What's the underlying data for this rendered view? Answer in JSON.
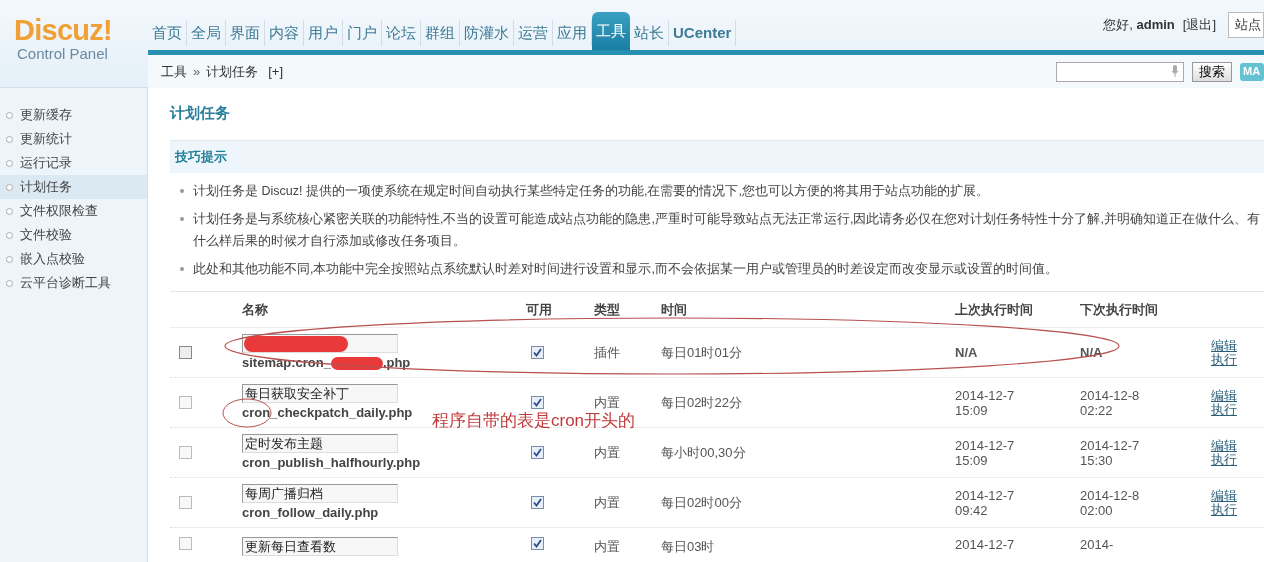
{
  "logo": {
    "title": "Discuz!",
    "subtitle": "Control Panel"
  },
  "nav": [
    {
      "label": "首页",
      "selected": false
    },
    {
      "label": "全局",
      "selected": false
    },
    {
      "label": "界面",
      "selected": false
    },
    {
      "label": "内容",
      "selected": false
    },
    {
      "label": "用户",
      "selected": false
    },
    {
      "label": "门户",
      "selected": false
    },
    {
      "label": "论坛",
      "selected": false
    },
    {
      "label": "群组",
      "selected": false
    },
    {
      "label": "防灌水",
      "selected": false
    },
    {
      "label": "运营",
      "selected": false
    },
    {
      "label": "应用",
      "selected": false
    },
    {
      "label": "工具",
      "selected": true
    },
    {
      "label": "站长",
      "selected": false
    },
    {
      "label": "UCenter",
      "selected": false
    }
  ],
  "user": {
    "greeting": "您好,",
    "name": "admin",
    "logout": "[退出]",
    "site_button": "站点"
  },
  "breadcrumb": {
    "parent": "工具",
    "separator": "»",
    "current": "计划任务",
    "add": "[+]"
  },
  "search": {
    "button": "搜索",
    "extra_button": "MA"
  },
  "sidebar": {
    "items": [
      {
        "label": "更新缓存",
        "selected": false
      },
      {
        "label": "更新统计",
        "selected": false
      },
      {
        "label": "运行记录",
        "selected": false
      },
      {
        "label": "计划任务",
        "selected": true
      },
      {
        "label": "文件权限检查",
        "selected": false
      },
      {
        "label": "文件校验",
        "selected": false
      },
      {
        "label": "嵌入点校验",
        "selected": false
      },
      {
        "label": "云平台诊断工具",
        "selected": false
      }
    ]
  },
  "page_title": "计划任务",
  "tips": {
    "title": "技巧提示",
    "items": [
      "计划任务是 Discuz! 提供的一项使系统在规定时间自动执行某些特定任务的功能,在需要的情况下,您也可以方便的将其用于站点功能的扩展。",
      "计划任务是与系统核心紧密关联的功能特性,不当的设置可能造成站点功能的隐患,严重时可能导致站点无法正常运行,因此请务必仅在您对计划任务特性十分了解,并明确知道正在做什么、有什么样后果的时候才自行添加或修改任务项目。",
      "此处和其他功能不同,本功能中完全按照站点系统默认时差对时间进行设置和显示,而不会依据某一用户或管理员的时差设定而改变显示或设置的时间值。"
    ]
  },
  "table": {
    "columns": [
      "名称",
      "可用",
      "类型",
      "时间",
      "上次执行时间",
      "下次执行时间"
    ],
    "rows": [
      {
        "selected": false,
        "name": "",
        "redacted": true,
        "file_prefix": "sitemap:cron_",
        "file_suffix": ".php",
        "enabled": true,
        "type": "插件",
        "time": "每日01时01分",
        "last_run": "N/A",
        "next_run": "N/A",
        "edit": "编辑",
        "run": "执行"
      },
      {
        "selected": false,
        "name": "每日获取安全补丁",
        "file_prefix": "cron_checkpatch_daily.php",
        "file_suffix": "",
        "enabled": true,
        "type": "内置",
        "time": "每日02时22分",
        "last_run": "2014-12-7 15:09",
        "next_run": "2014-12-8 02:22",
        "edit": "编辑",
        "run": "执行"
      },
      {
        "selected": false,
        "name": "定时发布主题",
        "file_prefix": "cron_publish_halfhourly.php",
        "file_suffix": "",
        "enabled": true,
        "type": "内置",
        "time": "每小时00,30分",
        "last_run": "2014-12-7 15:09",
        "next_run": "2014-12-7 15:30",
        "edit": "编辑",
        "run": "执行"
      },
      {
        "selected": false,
        "name": "每周广播归档",
        "file_prefix": "cron_follow_daily.php",
        "file_suffix": "",
        "enabled": true,
        "type": "内置",
        "time": "每日02时00分",
        "last_run": "2014-12-7 09:42",
        "next_run": "2014-12-8 02:00",
        "edit": "编辑",
        "run": "执行"
      },
      {
        "selected": false,
        "name": "更新每日查看数",
        "file_prefix": "",
        "file_suffix": "",
        "enabled": true,
        "type": "内置",
        "time": "每日03时",
        "last_run": "2014-12-7",
        "next_run": "2014-",
        "edit": "",
        "run": ""
      }
    ]
  },
  "annotation": {
    "text": "程序自带的表是cron开头的"
  }
}
